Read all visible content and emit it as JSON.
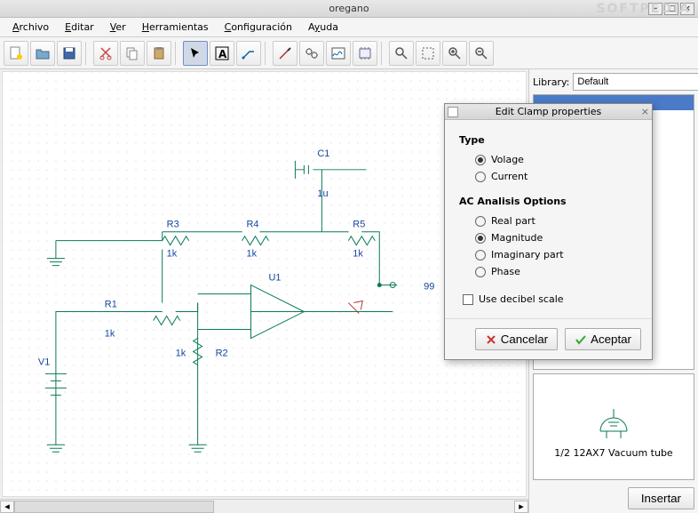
{
  "window": {
    "title": "oregano"
  },
  "menu": {
    "items": [
      {
        "label": "Archivo",
        "accel": "A"
      },
      {
        "label": "Editar",
        "accel": "E"
      },
      {
        "label": "Ver",
        "accel": "V"
      },
      {
        "label": "Herramientas",
        "accel": "H"
      },
      {
        "label": "Configuración",
        "accel": "C"
      },
      {
        "label": "Ayuda",
        "accel": "A"
      }
    ]
  },
  "toolbar": {
    "buttons": [
      {
        "name": "new",
        "icon": "sparkle"
      },
      {
        "name": "open",
        "icon": "folder"
      },
      {
        "name": "save",
        "icon": "disk"
      },
      {
        "sep": true
      },
      {
        "name": "cut",
        "icon": "scissors"
      },
      {
        "name": "copy",
        "icon": "copy"
      },
      {
        "name": "paste",
        "icon": "paste"
      },
      {
        "sep": true
      },
      {
        "name": "pointer",
        "icon": "arrow",
        "selected": true
      },
      {
        "name": "text",
        "icon": "textA"
      },
      {
        "name": "wire",
        "icon": "wire"
      },
      {
        "sep": true
      },
      {
        "name": "probe",
        "icon": "probe"
      },
      {
        "name": "simulate",
        "icon": "gears"
      },
      {
        "name": "plot",
        "icon": "plot"
      },
      {
        "name": "parts",
        "icon": "parts"
      },
      {
        "sep": true
      },
      {
        "name": "find",
        "icon": "magnify"
      },
      {
        "name": "extents",
        "icon": "bounds"
      },
      {
        "name": "zoom-in",
        "icon": "zoomin"
      },
      {
        "name": "zoom-out",
        "icon": "zoomout"
      }
    ]
  },
  "library": {
    "label": "Library:",
    "value": "Default"
  },
  "preview": {
    "name": "1/2 12AX7 Vacuum tube"
  },
  "insert_label": "Insertar",
  "dialog": {
    "title": "Edit Clamp properties",
    "type_label": "Type",
    "type_options": [
      {
        "label": "Volage",
        "checked": true
      },
      {
        "label": "Current",
        "checked": false
      }
    ],
    "ac_label": "AC Analisis Options",
    "ac_options": [
      {
        "label": "Real part",
        "checked": false
      },
      {
        "label": "Magnitude",
        "checked": true
      },
      {
        "label": "Imaginary part",
        "checked": false
      },
      {
        "label": "Phase",
        "checked": false
      }
    ],
    "decibel_label": "Use decibel scale",
    "cancel": "Cancelar",
    "accept": "Aceptar"
  },
  "schematic": {
    "labels": {
      "C1": "C1",
      "C1v": "1u",
      "R3": "R3",
      "R3v": "1k",
      "R4": "R4",
      "R4v": "1k",
      "R5": "R5",
      "R5v": "1k",
      "R1": "R1",
      "R1v": "1k",
      "R2": "R2",
      "R2v": "1k",
      "V1": "V1",
      "U1": "U1",
      "net": "99"
    }
  },
  "watermark": "SOFTPEDIA"
}
